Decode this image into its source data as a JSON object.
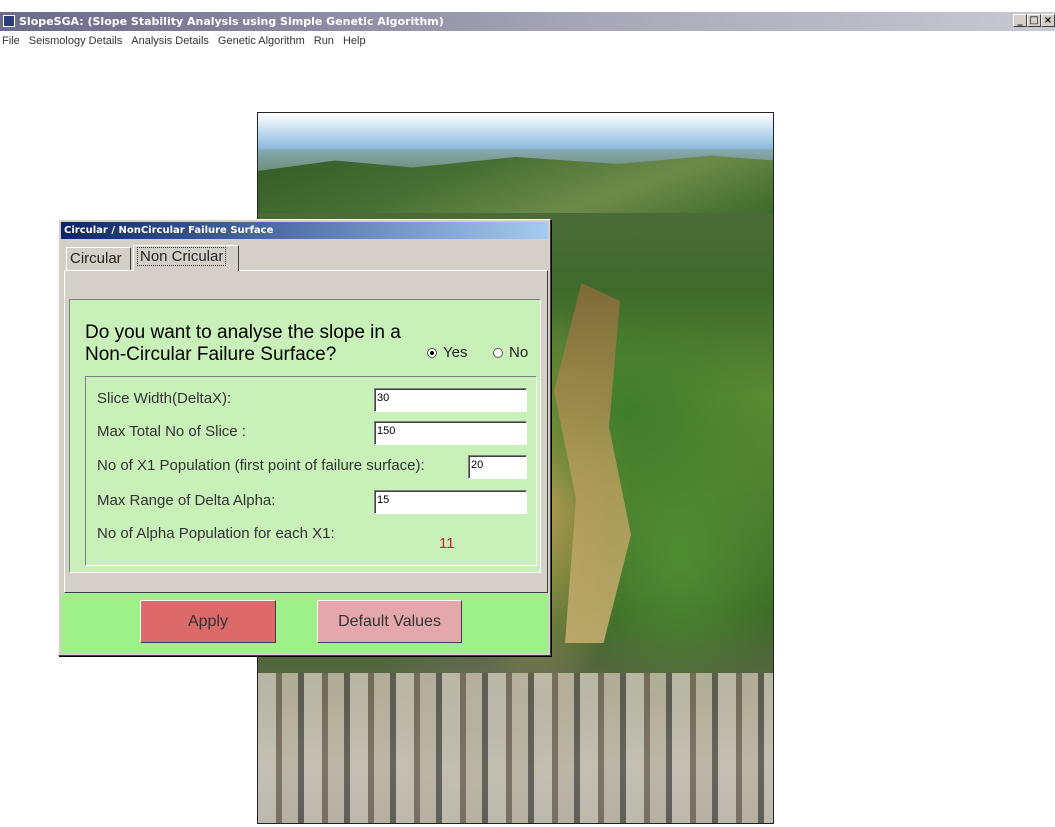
{
  "window": {
    "title": "SlopeSGA: (Slope Stability Analysis using Simple Genetic Algorithm)",
    "controls": [
      "_",
      "□",
      "×"
    ]
  },
  "menu": {
    "items": [
      "File",
      "Seismology Details",
      "Analysis Details",
      "Genetic Algorithm",
      "Run",
      "Help"
    ]
  },
  "dialog": {
    "title": "Circular / NonCircular Failure Surface",
    "tabs": [
      {
        "label": "Circular",
        "active": false
      },
      {
        "label": "Non Cricular",
        "active": true
      }
    ],
    "question_line1": "Do you want to analyse the slope in a",
    "question_line2": "Non-Circular Failure Surface?",
    "radio_yes": "Yes",
    "radio_no": "No",
    "selected": "Yes",
    "params": {
      "slice_width_label": "Slice Width(DeltaX):",
      "slice_width_value": "30",
      "max_slices_label": "Max Total No of Slice :",
      "max_slices_value": "150",
      "x1_population_label": "No of X1 Population (first point of failure surface):",
      "x1_population_value": "20",
      "delta_alpha_label": "Max Range of Delta Alpha:",
      "delta_alpha_value": "15",
      "alpha_population_label": "No of Alpha Population for each X1:",
      "alpha_population_value": "11"
    },
    "apply_label": "Apply",
    "default_label": "Default Values"
  },
  "colors": {
    "panel_green": "#c8f0b8",
    "bar_green": "#9ef089",
    "apply_red": "#dc6a6a",
    "default_pink": "#e4a8ac",
    "title_blue": "#0a246a"
  }
}
